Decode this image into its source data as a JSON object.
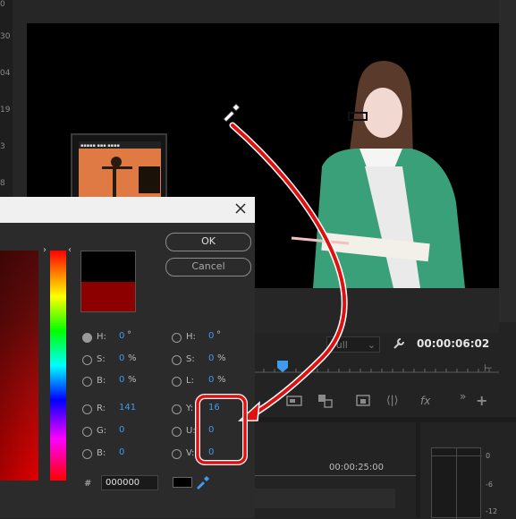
{
  "ruler": {
    "ticks": [
      "0",
      "30",
      "04",
      "19",
      "3",
      "8"
    ]
  },
  "monitor": {
    "zoom": "Full",
    "timecode": "00:00:06:02",
    "timeline_timecode": "00:00:25:00",
    "meter_labels": [
      "0",
      "-6",
      "-12"
    ]
  },
  "dialog": {
    "ok_label": "OK",
    "cancel_label": "Cancel",
    "hsb": {
      "h_label": "H:",
      "h_value": "0",
      "h_unit": "°",
      "s_label": "S:",
      "s_value": "0",
      "s_unit": "%",
      "b_label": "B:",
      "b_value": "0",
      "b_unit": "%"
    },
    "hsl": {
      "h_label": "H:",
      "h_value": "0",
      "h_unit": "°",
      "s_label": "S:",
      "s_value": "0",
      "s_unit": "%",
      "l_label": "L:",
      "l_value": "0",
      "l_unit": "%"
    },
    "rgb": {
      "r_label": "R:",
      "r_value": "141",
      "g_label": "G:",
      "g_value": "0",
      "b_label": "B:",
      "b_value": "0"
    },
    "yuv": {
      "y_label": "Y:",
      "y_value": "16",
      "u_label": "U:",
      "u_value": "0",
      "v_label": "V:",
      "v_value": "0"
    },
    "hex_label": "#",
    "hex_value": "000000"
  },
  "colors": {
    "new_color": "#000000",
    "original_color": "#8d0000",
    "accent_blue": "#3d9bf0",
    "annotation_red": "#e01010"
  },
  "icons": [
    "close-icon",
    "eyedropper-icon",
    "wrench-icon",
    "fx-icon",
    "playhead-icon"
  ]
}
